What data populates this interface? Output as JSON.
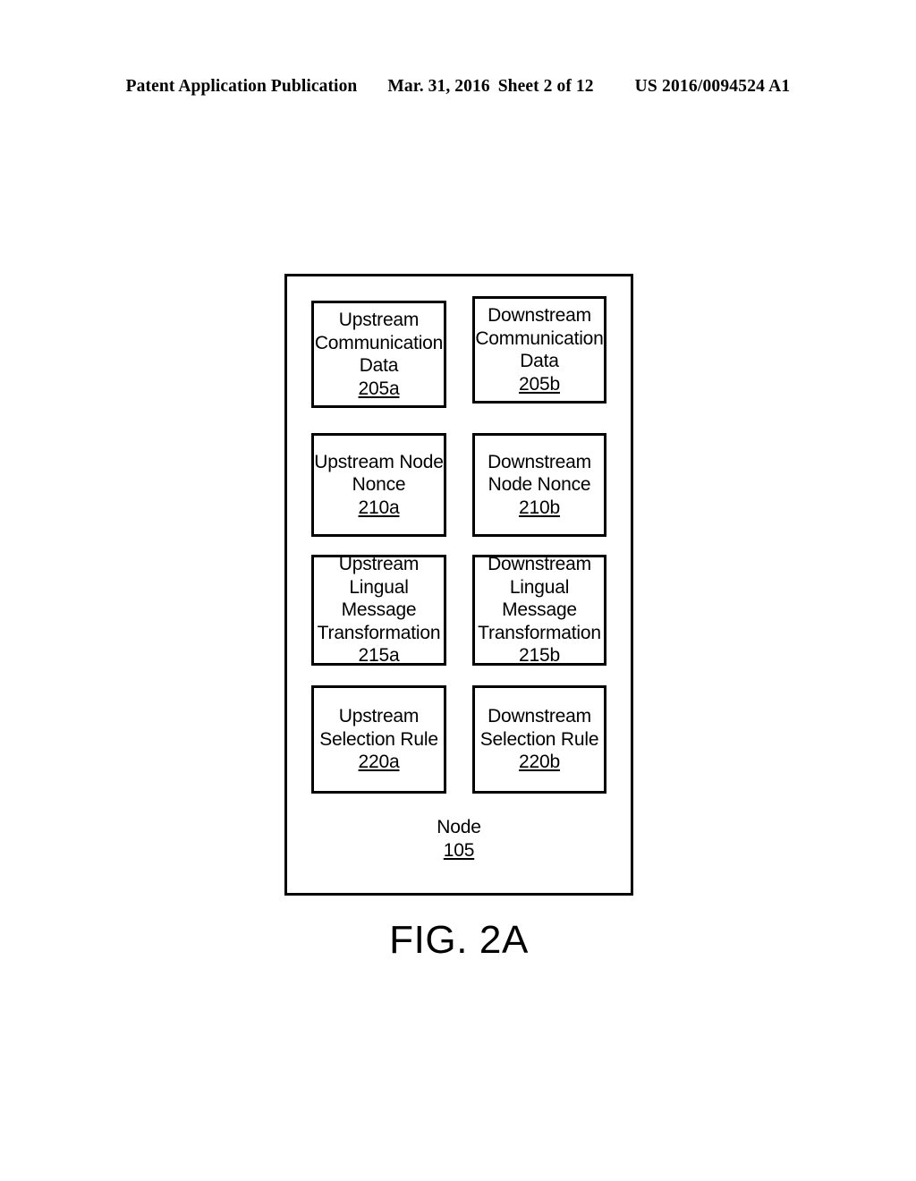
{
  "header": {
    "publication": "Patent Application Publication",
    "date": "Mar. 31, 2016",
    "sheet": "Sheet 2 of 12",
    "doc_number": "US 2016/0094524 A1"
  },
  "figure": {
    "caption": "FIG. 2A",
    "container": {
      "label": "Node",
      "ref": "105"
    },
    "components": [
      {
        "id": "205a",
        "column": "upstream",
        "row": 1,
        "lines": [
          "Upstream",
          "Communication",
          "Data"
        ],
        "ref": "205a"
      },
      {
        "id": "205b",
        "column": "downstream",
        "row": 1,
        "lines": [
          "Downstream",
          "Communication",
          "Data"
        ],
        "ref": "205b"
      },
      {
        "id": "210a",
        "column": "upstream",
        "row": 2,
        "lines": [
          "Upstream Node",
          "Nonce"
        ],
        "ref": "210a"
      },
      {
        "id": "210b",
        "column": "downstream",
        "row": 2,
        "lines": [
          "Downstream",
          "Node Nonce"
        ],
        "ref": "210b"
      },
      {
        "id": "215a",
        "column": "upstream",
        "row": 3,
        "lines": [
          "Upstream",
          "Lingual",
          "Message",
          "Transformation"
        ],
        "ref": "215a"
      },
      {
        "id": "215b",
        "column": "downstream",
        "row": 3,
        "lines": [
          "Downstream",
          "Lingual",
          "Message",
          "Transformation"
        ],
        "ref": "215b"
      },
      {
        "id": "220a",
        "column": "upstream",
        "row": 4,
        "lines": [
          "Upstream",
          "Selection Rule"
        ],
        "ref": "220a"
      },
      {
        "id": "220b",
        "column": "downstream",
        "row": 4,
        "lines": [
          "Downstream",
          "Selection Rule"
        ],
        "ref": "220b"
      }
    ]
  },
  "colors": {
    "ink": "#000000",
    "paper": "#ffffff"
  }
}
